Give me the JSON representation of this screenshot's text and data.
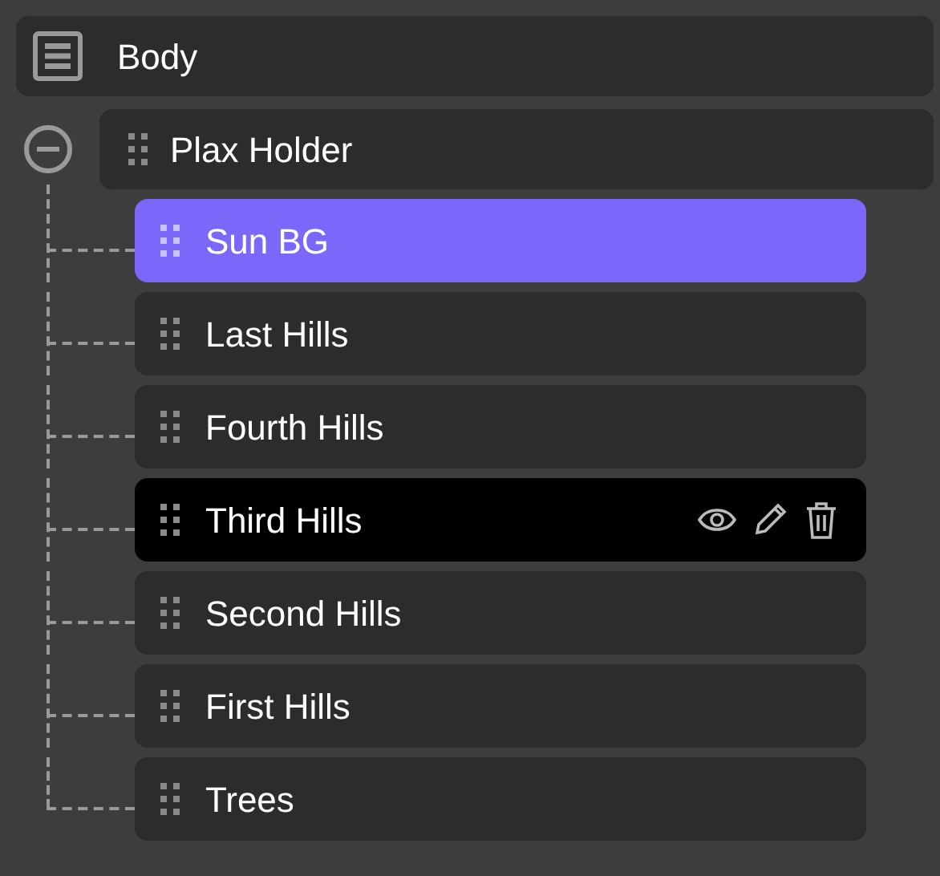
{
  "root": {
    "label": "Body"
  },
  "group": {
    "label": "Plax Holder",
    "expanded": true,
    "children": [
      {
        "label": "Sun BG",
        "selected": true,
        "hovered": false
      },
      {
        "label": "Last Hills",
        "selected": false,
        "hovered": false
      },
      {
        "label": "Fourth Hills",
        "selected": false,
        "hovered": false
      },
      {
        "label": "Third Hills",
        "selected": false,
        "hovered": true
      },
      {
        "label": "Second Hills",
        "selected": false,
        "hovered": false
      },
      {
        "label": "First Hills",
        "selected": false,
        "hovered": false
      },
      {
        "label": "Trees",
        "selected": false,
        "hovered": false
      }
    ]
  }
}
